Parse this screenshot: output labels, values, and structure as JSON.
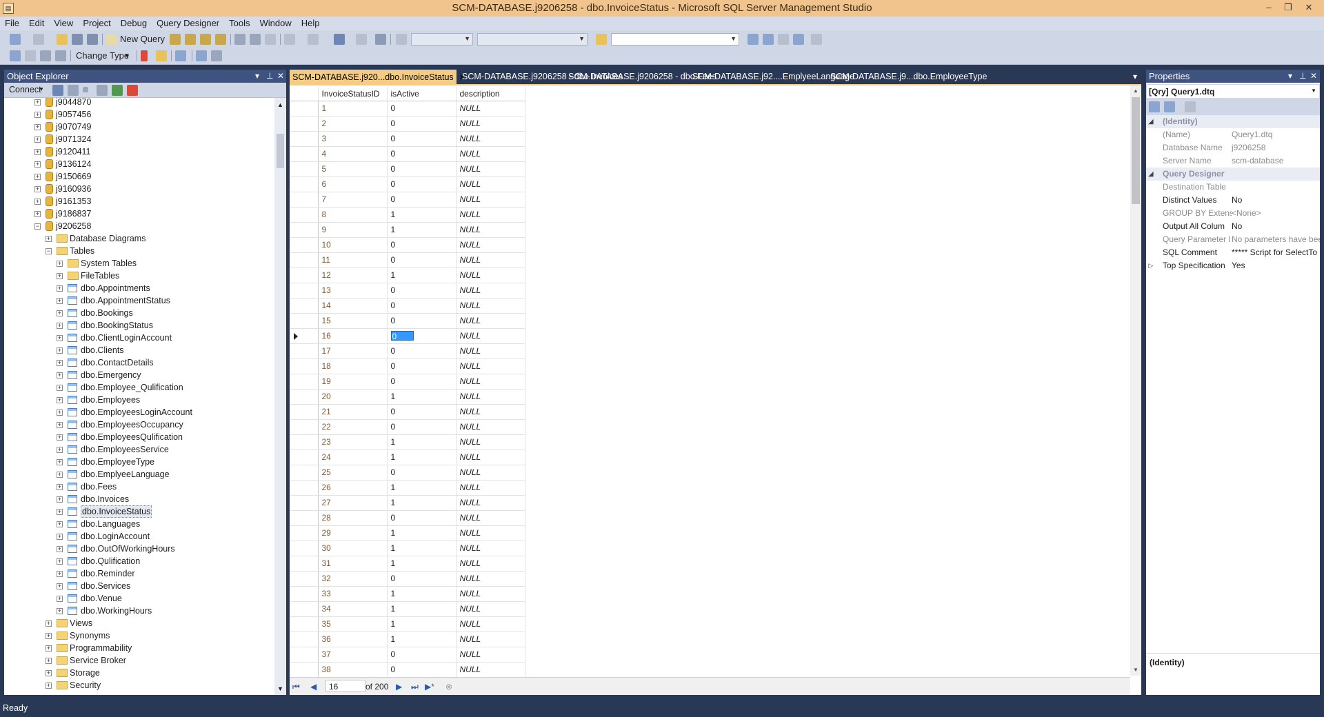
{
  "window": {
    "title": "SCM-DATABASE.j9206258 - dbo.InvoiceStatus - Microsoft SQL Server Management Studio"
  },
  "menu": [
    "File",
    "Edit",
    "View",
    "Project",
    "Debug",
    "Query Designer",
    "Tools",
    "Window",
    "Help"
  ],
  "toolbar": {
    "new_query": "New Query",
    "change_type": "Change Type"
  },
  "object_explorer": {
    "title": "Object Explorer",
    "connect": "Connect",
    "databases": [
      "j9044870",
      "j9057456",
      "j9070749",
      "j9071324",
      "j9120411",
      "j9136124",
      "j9150669",
      "j9160936",
      "j9161353",
      "j9186837"
    ],
    "expanded_db": "j9206258",
    "db_folders": [
      "Database Diagrams",
      "Tables"
    ],
    "table_folders": [
      "System Tables",
      "FileTables"
    ],
    "tables": [
      "dbo.Appointments",
      "dbo.AppointmentStatus",
      "dbo.Bookings",
      "dbo.BookingStatus",
      "dbo.ClientLoginAccount",
      "dbo.Clients",
      "dbo.ContactDetails",
      "dbo.Emergency",
      "dbo.Employee_Qulification",
      "dbo.Employees",
      "dbo.EmployeesLoginAccount",
      "dbo.EmployeesOccupancy",
      "dbo.EmployeesQulification",
      "dbo.EmployeesService",
      "dbo.EmployeeType",
      "dbo.EmplyeeLanguage",
      "dbo.Fees",
      "dbo.Invoices",
      "dbo.InvoiceStatus",
      "dbo.Languages",
      "dbo.LoginAccount",
      "dbo.OutOfWorkingHours",
      "dbo.Qulification",
      "dbo.Reminder",
      "dbo.Services",
      "dbo.Venue",
      "dbo.WorkingHours"
    ],
    "selected_table": "dbo.InvoiceStatus",
    "after_tables": [
      "Views",
      "Synonyms",
      "Programmability",
      "Service Broker",
      "Storage",
      "Security"
    ]
  },
  "tabs": [
    {
      "label": "SCM-DATABASE.j920...dbo.InvoiceStatus",
      "active": true
    },
    {
      "label": "SCM-DATABASE.j9206258 - dbo.Invoices",
      "active": false
    },
    {
      "label": "SCM-DATABASE.j9206258 - dbo.Fees",
      "active": false
    },
    {
      "label": "SCM-DATABASE.j92....EmplyeeLanguage",
      "active": false
    },
    {
      "label": "SCM-DATABASE.j9...dbo.EmployeeType",
      "active": false
    }
  ],
  "grid": {
    "columns": [
      "InvoiceStatusID",
      "isActive",
      "description"
    ],
    "rows": [
      [
        "1",
        "0",
        "NULL"
      ],
      [
        "2",
        "0",
        "NULL"
      ],
      [
        "3",
        "0",
        "NULL"
      ],
      [
        "4",
        "0",
        "NULL"
      ],
      [
        "5",
        "0",
        "NULL"
      ],
      [
        "6",
        "0",
        "NULL"
      ],
      [
        "7",
        "0",
        "NULL"
      ],
      [
        "8",
        "1",
        "NULL"
      ],
      [
        "9",
        "1",
        "NULL"
      ],
      [
        "10",
        "0",
        "NULL"
      ],
      [
        "11",
        "0",
        "NULL"
      ],
      [
        "12",
        "1",
        "NULL"
      ],
      [
        "13",
        "0",
        "NULL"
      ],
      [
        "14",
        "0",
        "NULL"
      ],
      [
        "15",
        "0",
        "NULL"
      ],
      [
        "16",
        "0",
        "NULL"
      ],
      [
        "17",
        "0",
        "NULL"
      ],
      [
        "18",
        "0",
        "NULL"
      ],
      [
        "19",
        "0",
        "NULL"
      ],
      [
        "20",
        "1",
        "NULL"
      ],
      [
        "21",
        "0",
        "NULL"
      ],
      [
        "22",
        "0",
        "NULL"
      ],
      [
        "23",
        "1",
        "NULL"
      ],
      [
        "24",
        "1",
        "NULL"
      ],
      [
        "25",
        "0",
        "NULL"
      ],
      [
        "26",
        "1",
        "NULL"
      ],
      [
        "27",
        "1",
        "NULL"
      ],
      [
        "28",
        "0",
        "NULL"
      ],
      [
        "29",
        "1",
        "NULL"
      ],
      [
        "30",
        "1",
        "NULL"
      ],
      [
        "31",
        "1",
        "NULL"
      ],
      [
        "32",
        "0",
        "NULL"
      ],
      [
        "33",
        "1",
        "NULL"
      ],
      [
        "34",
        "1",
        "NULL"
      ],
      [
        "35",
        "1",
        "NULL"
      ],
      [
        "36",
        "1",
        "NULL"
      ],
      [
        "37",
        "0",
        "NULL"
      ],
      [
        "38",
        "0",
        "NULL"
      ]
    ],
    "current_row": 16,
    "nav": {
      "current": "16",
      "of": "of 200"
    }
  },
  "properties": {
    "title": "Properties",
    "object": "[Qry] Query1.dtq",
    "rows": [
      {
        "type": "cat",
        "name": "(Identity)"
      },
      {
        "type": "ro",
        "name": "(Name)",
        "value": "Query1.dtq"
      },
      {
        "type": "ro",
        "name": "Database Name",
        "value": "j9206258"
      },
      {
        "type": "ro",
        "name": "Server Name",
        "value": "scm-database"
      },
      {
        "type": "cat",
        "name": "Query Designer"
      },
      {
        "type": "ro",
        "name": "Destination Table",
        "value": ""
      },
      {
        "type": "rw",
        "name": "Distinct Values",
        "value": "No"
      },
      {
        "type": "ro",
        "name": "GROUP BY Extensi",
        "value": "<None>"
      },
      {
        "type": "rw",
        "name": "Output All Colum",
        "value": "No"
      },
      {
        "type": "ro",
        "name": "Query Parameter l",
        "value": "No parameters have bee"
      },
      {
        "type": "rw",
        "name": "SQL Comment",
        "value": "***** Script for SelectTo"
      },
      {
        "type": "exp",
        "name": "Top Specification",
        "value": "Yes"
      }
    ],
    "description_title": "(Identity)"
  },
  "status": {
    "text": "Ready"
  }
}
